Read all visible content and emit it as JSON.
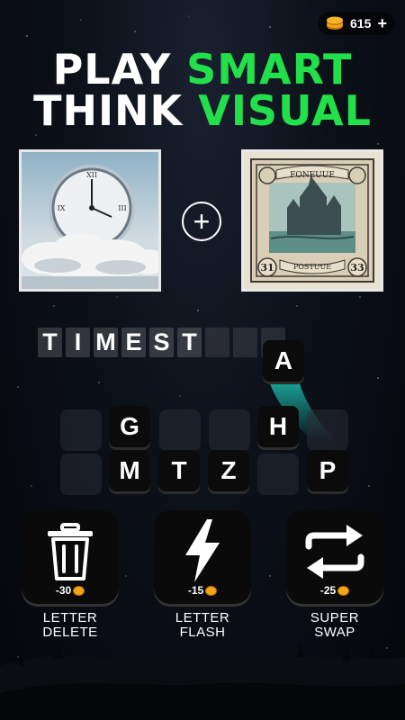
{
  "header": {
    "coins": "615",
    "add_label": "+"
  },
  "headline": {
    "line1_white": "PLAY ",
    "line1_green": "SMART",
    "line2_white": "THINK ",
    "line2_green": "VISUAL"
  },
  "clue": {
    "left_image": "clock-in-clouds",
    "right_image": "vintage-postage-stamp",
    "right_image_text_top": "FONEUUE",
    "right_image_text_bottom": "POSTUUE",
    "right_image_num_left": "31",
    "right_image_num_right": "33",
    "plus_symbol": "+"
  },
  "answer": {
    "letters": [
      "T",
      "I",
      "M",
      "E",
      "S",
      "T",
      "",
      "",
      ""
    ],
    "flying_letter": "A"
  },
  "keyboard": {
    "row1": [
      "",
      "G",
      "",
      "",
      "H",
      ""
    ],
    "row2": [
      "",
      "M",
      "T",
      "Z",
      "",
      "P"
    ]
  },
  "powerups": [
    {
      "name": "LETTER\nDELETE",
      "line1": "LETTER",
      "line2": "DELETE",
      "cost": "-30",
      "icon": "trash-icon"
    },
    {
      "name": "LETTER\nFLASH",
      "line1": "LETTER",
      "line2": "FLASH",
      "cost": "-15",
      "icon": "lightning-icon"
    },
    {
      "name": "SUPER\nSWAP",
      "line1": "SUPER",
      "line2": "SWAP",
      "cost": "-25",
      "icon": "swap-icon"
    }
  ],
  "colors": {
    "accent_green": "#22e04a",
    "coin_gold": "#f2a51a"
  }
}
